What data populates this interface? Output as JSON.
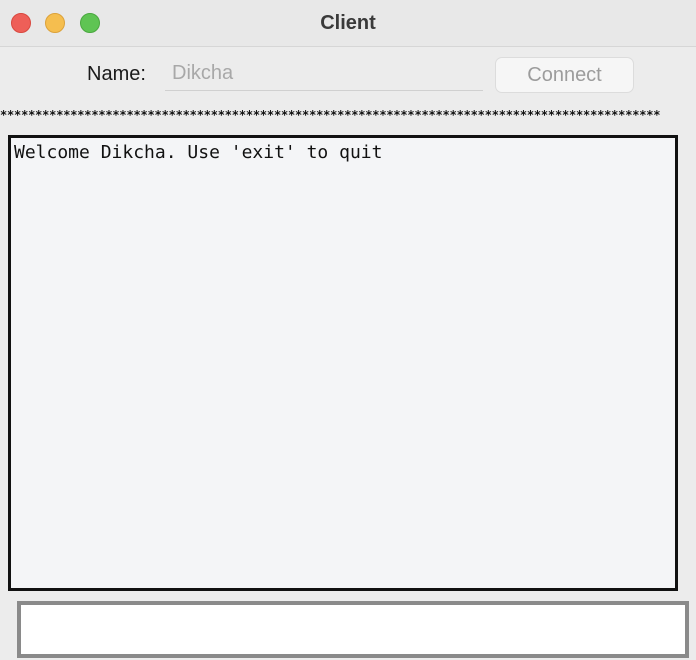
{
  "window": {
    "title": "Client",
    "traffic_lights": {
      "close": "#ee5f58",
      "minimize": "#f5be4f",
      "zoom": "#5fc453"
    }
  },
  "form": {
    "name_label": "Name:",
    "name_value": "Dikcha",
    "connect_label": "Connect"
  },
  "separator": "**********************************************************************************************",
  "chat": {
    "messages": [
      "Welcome Dikcha. Use 'exit' to quit"
    ]
  },
  "message_input": {
    "value": ""
  }
}
